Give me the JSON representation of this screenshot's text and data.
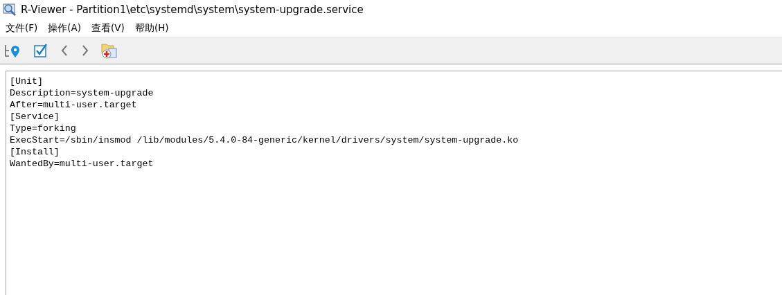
{
  "window": {
    "title": "R-Viewer - Partition1\\etc\\systemd\\system\\system-upgrade.service"
  },
  "menu": [
    "文件(F)",
    "操作(A)",
    "查看(V)",
    "帮助(H)"
  ],
  "file_content": [
    "[Unit]",
    "Description=system-upgrade",
    "After=multi-user.target",
    "[Service]",
    "Type=forking",
    "ExecStart=/sbin/insmod /lib/modules/5.4.0-84-generic/kernel/drivers/system/system-upgrade.ko",
    "[Install]",
    "WantedBy=multi-user.target"
  ]
}
